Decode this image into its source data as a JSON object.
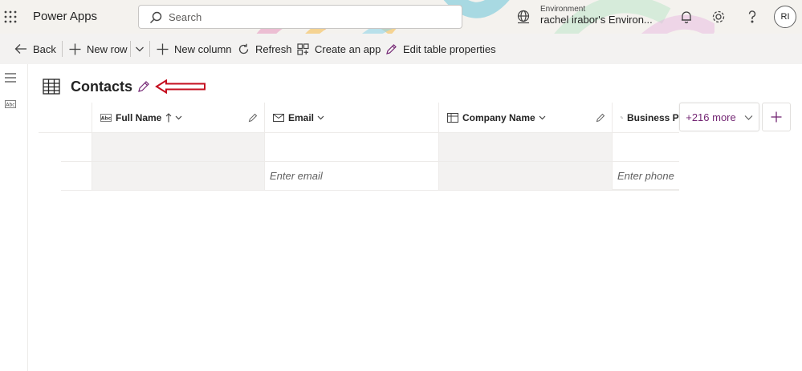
{
  "header": {
    "app_title": "Power Apps",
    "search_placeholder": "Search",
    "environment_label": "Environment",
    "environment_name": "rachel irabor's Environ...",
    "avatar_initials": "RI",
    "colors": {
      "accent": "#742774",
      "header_bg": "#f4f2ee"
    }
  },
  "commands": {
    "back": "Back",
    "new_row": "New row",
    "new_column": "New column",
    "refresh": "Refresh",
    "create_app": "Create an app",
    "edit_table_properties": "Edit table properties"
  },
  "page": {
    "title": "Contacts",
    "annotation_color": "#c50f1f"
  },
  "grid": {
    "columns": [
      {
        "label": "Full Name",
        "icon": "text-type-icon",
        "sorted": "ascending"
      },
      {
        "label": "Email",
        "icon": "mail-icon"
      },
      {
        "label": "Company Name",
        "icon": "lookup-icon"
      },
      {
        "label": "Business Ph",
        "icon": "phone-icon"
      }
    ],
    "new_row_placeholders": {
      "email": "Enter email",
      "phone": "Enter phone"
    },
    "more_columns": "+216 more"
  }
}
